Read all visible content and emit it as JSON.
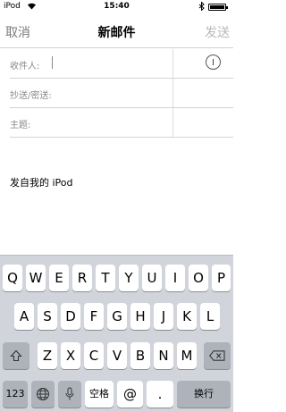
{
  "status_bar": {
    "carrier": "iPod",
    "wifi_icon": "wifi-icon",
    "time": "15:40",
    "bluetooth_icon": "bluetooth-icon",
    "battery_icon": "battery-icon"
  },
  "nav": {
    "cancel_label": "取消",
    "title": "新邮件",
    "send_label": "发送"
  },
  "compose": {
    "to_label": "收件人:",
    "cc_bcc_label": "抄送/密送:",
    "subject_label": "主题:",
    "add_contact_icon": "add-contact-icon",
    "body_text": "发自我的 iPod"
  },
  "keyboard": {
    "row1": [
      "Q",
      "W",
      "E",
      "R",
      "T",
      "Y",
      "U",
      "I",
      "O",
      "P"
    ],
    "row2": [
      "A",
      "S",
      "D",
      "F",
      "G",
      "H",
      "J",
      "K",
      "L"
    ],
    "row3": [
      "Z",
      "X",
      "C",
      "V",
      "B",
      "N",
      "M"
    ],
    "shift_icon": "shift-icon",
    "delete_icon": "delete-icon",
    "numbers_label": "123",
    "globe_icon": "globe-icon",
    "mic_icon": "microphone-icon",
    "space_label": "空格",
    "at_label": "@",
    "dot_label": ".",
    "return_label": "换行"
  },
  "colors": {
    "keyboard_bg": "#d1d5db",
    "key_bg": "#ffffff",
    "key_dark_bg": "#aeb3bb",
    "nav_cancel": "#7a7a7a",
    "nav_send_disabled": "#b9b9b9"
  }
}
